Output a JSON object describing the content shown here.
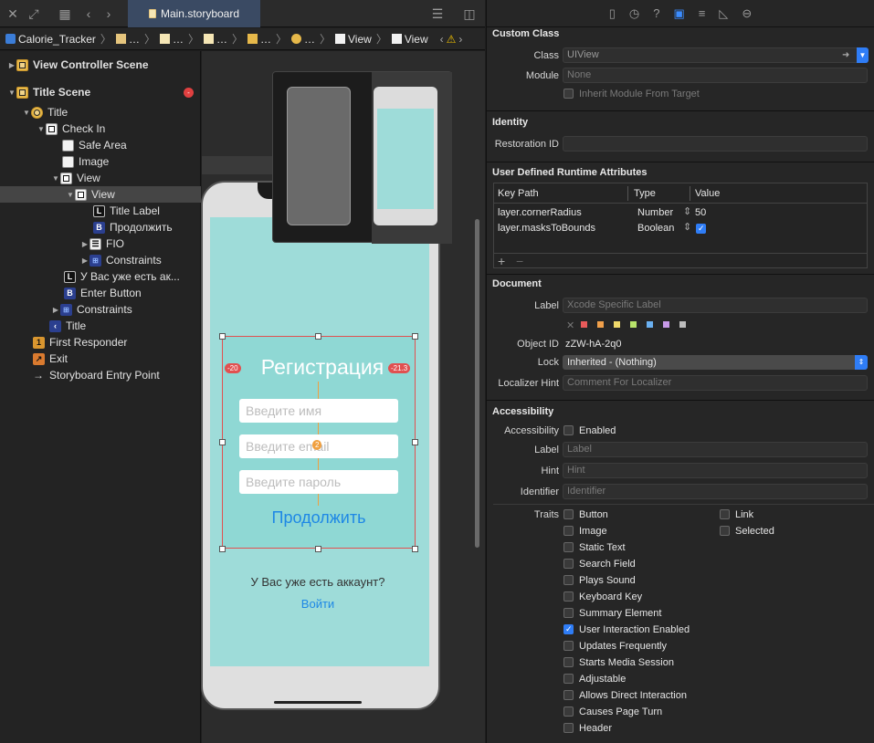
{
  "toolbar": {
    "tab_title": "Main.storyboard"
  },
  "breadcrumb": [
    "Calorie_Tracker",
    "…",
    "…",
    "…",
    "…",
    "…",
    "View",
    "View"
  ],
  "outline": [
    {
      "label": "View Controller Scene",
      "icon": "scene-icon"
    },
    {
      "label": "Title Scene",
      "icon": "scene-icon"
    },
    {
      "label": "Title",
      "icon": "view-controller-icon"
    },
    {
      "label": "Check In",
      "icon": "view-icon"
    },
    {
      "label": "Safe Area",
      "icon": "safe-area-icon"
    },
    {
      "label": "Image",
      "icon": "image-icon"
    },
    {
      "label": "View",
      "icon": "view-icon"
    },
    {
      "label": "View",
      "icon": "view-icon"
    },
    {
      "label": "Title Label",
      "icon": "label-icon"
    },
    {
      "label": "Продолжить",
      "icon": "button-icon"
    },
    {
      "label": "FIO",
      "icon": "stack-icon"
    },
    {
      "label": "Constraints",
      "icon": "constraints-icon"
    },
    {
      "label": "У Вас уже есть ак...",
      "icon": "label-icon"
    },
    {
      "label": "Enter Button",
      "icon": "button-icon"
    },
    {
      "label": "Constraints",
      "icon": "constraints-icon"
    },
    {
      "label": "Title",
      "icon": "navigation-item-icon"
    },
    {
      "label": "First Responder",
      "icon": "first-responder-icon"
    },
    {
      "label": "Exit",
      "icon": "exit-icon"
    },
    {
      "label": "Storyboard Entry Point",
      "icon": "arrow-icon"
    }
  ],
  "canvas": {
    "title": "Регистрация",
    "name_placeholder": "Введите имя",
    "email_placeholder": "Введите email",
    "password_placeholder": "Введите пароль",
    "continue": "Продолжить",
    "question": "У Вас уже есть аккаунт?",
    "login": "Войти",
    "left_const": "-20",
    "right_const": "-21.3",
    "center_const": "2"
  },
  "inspector": {
    "custom_class": {
      "header": "Custom Class",
      "class_label": "Class",
      "class_value": "UIView",
      "module_label": "Module",
      "module_value": "None",
      "inherit": "Inherit Module From Target"
    },
    "identity": {
      "header": "Identity",
      "restoration_label": "Restoration ID"
    },
    "runtime": {
      "header": "User Defined Runtime Attributes",
      "col_keypath": "Key Path",
      "col_type": "Type",
      "col_value": "Value",
      "rows": [
        {
          "key": "layer.cornerRadius",
          "type": "Number",
          "value": "50"
        },
        {
          "key": "layer.masksToBounds",
          "type": "Boolean",
          "value": "checked"
        }
      ]
    },
    "document": {
      "header": "Document",
      "label_label": "Label",
      "label_placeholder": "Xcode Specific Label",
      "object_id_label": "Object ID",
      "object_id": "zZW-hA-2q0",
      "lock_label": "Lock",
      "lock_value": "Inherited - (Nothing)",
      "localizer_label": "Localizer Hint",
      "localizer_placeholder": "Comment For Localizer",
      "swatches": [
        "#e85a5a",
        "#f0a04b",
        "#f0d96a",
        "#b8e36a",
        "#6ab0f0",
        "#c79ae8",
        "#bdbdbd"
      ]
    },
    "accessibility": {
      "header": "Accessibility",
      "accessibility_label": "Accessibility",
      "enabled": "Enabled",
      "label_label": "Label",
      "label_placeholder": "Label",
      "hint_label": "Hint",
      "hint_placeholder": "Hint",
      "identifier_label": "Identifier",
      "identifier_placeholder": "Identifier",
      "traits_label": "Traits",
      "traits_left": [
        {
          "name": "Button",
          "checked": false
        },
        {
          "name": "Image",
          "checked": false
        },
        {
          "name": "Static Text",
          "checked": false
        },
        {
          "name": "Search Field",
          "checked": false
        },
        {
          "name": "Plays Sound",
          "checked": false
        },
        {
          "name": "Keyboard Key",
          "checked": false
        },
        {
          "name": "Summary Element",
          "checked": false
        },
        {
          "name": "User Interaction Enabled",
          "checked": true
        },
        {
          "name": "Updates Frequently",
          "checked": false
        },
        {
          "name": "Starts Media Session",
          "checked": false
        },
        {
          "name": "Adjustable",
          "checked": false
        },
        {
          "name": "Allows Direct Interaction",
          "checked": false
        },
        {
          "name": "Causes Page Turn",
          "checked": false
        },
        {
          "name": "Header",
          "checked": false
        }
      ],
      "traits_right": [
        {
          "name": "Link",
          "checked": false
        },
        {
          "name": "Selected",
          "checked": false
        }
      ]
    }
  }
}
